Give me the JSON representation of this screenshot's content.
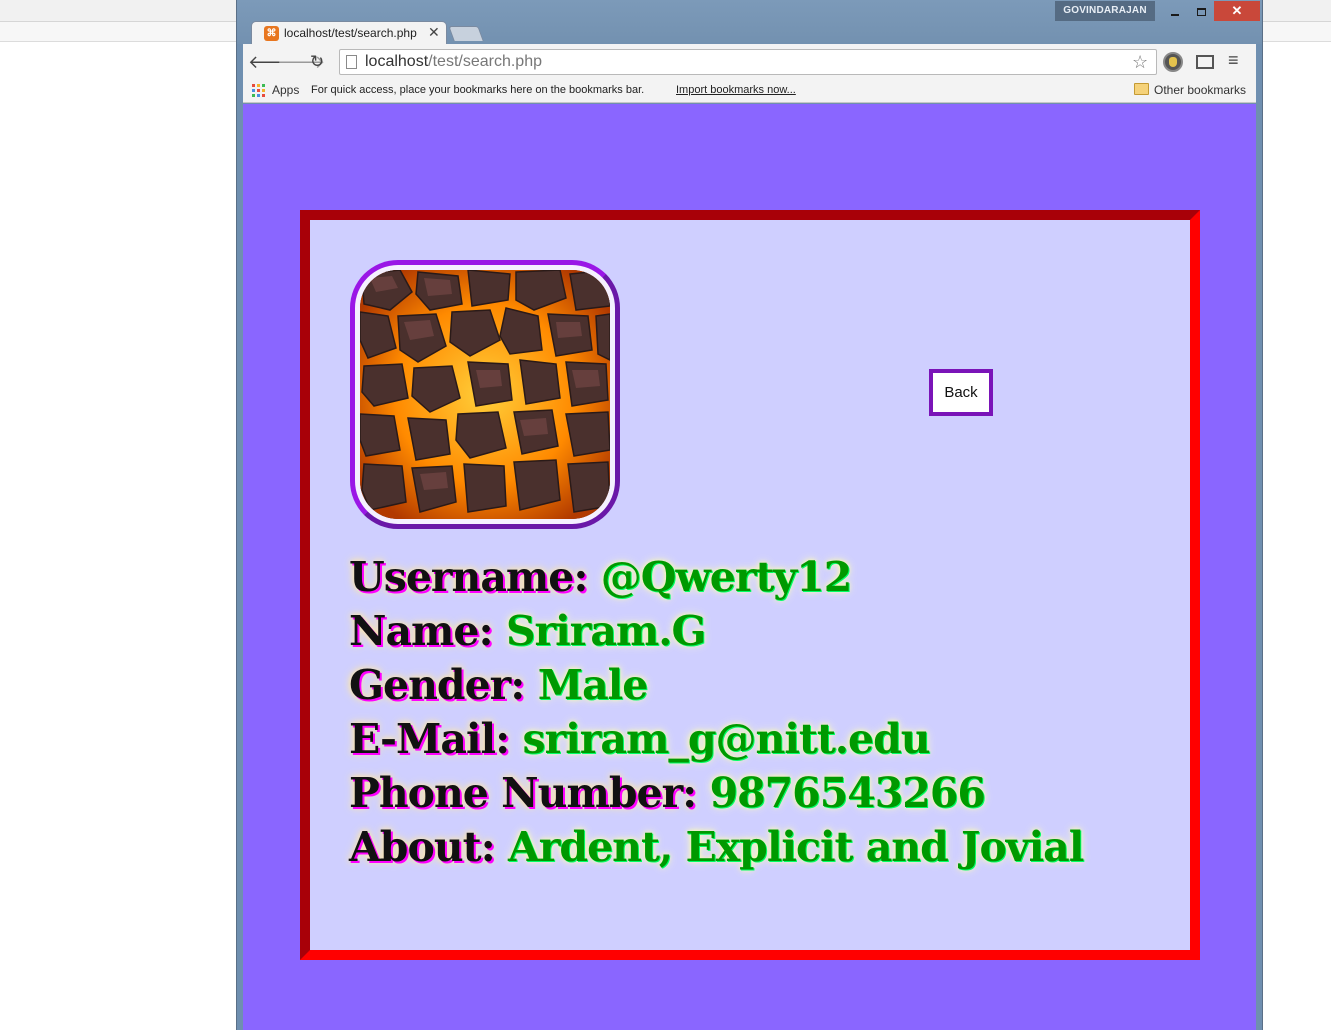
{
  "browser": {
    "profile_name": "GOVINDARAJAN",
    "tab_title": "localhost/test/search.php",
    "tab_favicon": "⌘",
    "url_host": "localhost",
    "url_path": "/test/search.php",
    "bookmarks": {
      "apps_label": "Apps",
      "hint": "For quick access, place your bookmarks here on the bookmarks bar.",
      "import_link": "Import bookmarks now...",
      "other_label": "Other bookmarks"
    },
    "icons": [
      "back-icon",
      "forward-icon",
      "reload-icon",
      "page-icon",
      "star-icon",
      "extension-icon",
      "cast-icon",
      "menu-icon",
      "apps-icon",
      "folder-icon"
    ]
  },
  "colors": {
    "page_background": "#8a66ff",
    "card_background": "#cfcfff",
    "card_border": "#ff0000",
    "avatar_border": "#9a17e6",
    "back_button_border": "#7a14b8",
    "label_color": "#111111",
    "label_shadow": "#ff00ff",
    "value_color": "#009900"
  },
  "page": {
    "back_button_label": "Back",
    "avatar_alt": "lava rock texture",
    "profile": [
      {
        "label": "Username:",
        "value": "@Qwerty12"
      },
      {
        "label": "Name:",
        "value": "Sriram.G"
      },
      {
        "label": "Gender:",
        "value": "Male"
      },
      {
        "label": "E-Mail:",
        "value": "sriram_g@nitt.edu"
      },
      {
        "label": "Phone Number:",
        "value": "9876543266"
      },
      {
        "label": "About:",
        "value": "Ardent, Explicit and Jovial"
      }
    ]
  }
}
